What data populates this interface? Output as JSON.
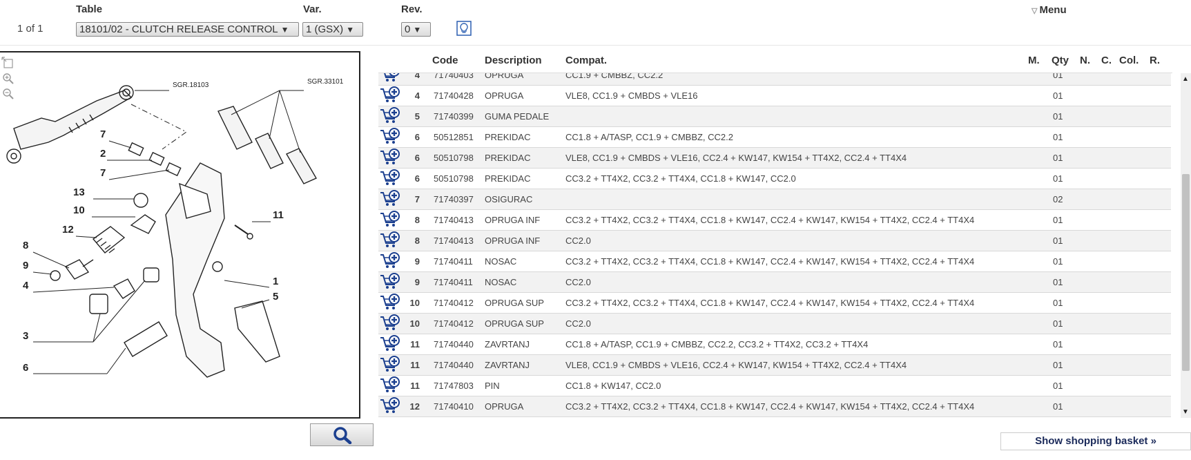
{
  "header": {
    "counter": "1 of 1",
    "table_label": "Table",
    "var_label": "Var.",
    "rev_label": "Rev.",
    "table_value": "18101/02 - CLUTCH RELEASE CONTROL",
    "var_value": "1 (GSX)",
    "rev_value": "0",
    "menu_label": "Menu"
  },
  "diagram": {
    "labels": [
      "7",
      "2",
      "7",
      "13",
      "10",
      "12",
      "8",
      "9",
      "4",
      "3",
      "6",
      "11",
      "1",
      "5"
    ],
    "refs": [
      "SGR.18103",
      "SGR.33101"
    ]
  },
  "table": {
    "headers": [
      "Code",
      "Description",
      "Compat.",
      "M.",
      "Qty",
      "N.",
      "C.",
      "Col.",
      "R."
    ],
    "rows": [
      {
        "pos": "4",
        "code": "71740403",
        "desc": "OPRUGA",
        "compat": "CC1.9 + CMBBZ, CC2.2",
        "qty": "01"
      },
      {
        "pos": "4",
        "code": "71740428",
        "desc": "OPRUGA",
        "compat": "VLE8, CC1.9 + CMBDS + VLE16",
        "qty": "01"
      },
      {
        "pos": "5",
        "code": "71740399",
        "desc": "GUMA PEDALE",
        "compat": "",
        "qty": "01"
      },
      {
        "pos": "6",
        "code": "50512851",
        "desc": "PREKIDAC",
        "compat": "CC1.8 + A/TASP, CC1.9 + CMBBZ, CC2.2",
        "qty": "01"
      },
      {
        "pos": "6",
        "code": "50510798",
        "desc": "PREKIDAC",
        "compat": "VLE8, CC1.9 + CMBDS + VLE16, CC2.4 + KW147, KW154 + TT4X2, CC2.4 + TT4X4",
        "qty": "01"
      },
      {
        "pos": "6",
        "code": "50510798",
        "desc": "PREKIDAC",
        "compat": "CC3.2 + TT4X2, CC3.2 + TT4X4, CC1.8 + KW147, CC2.0",
        "qty": "01"
      },
      {
        "pos": "7",
        "code": "71740397",
        "desc": "OSIGURAC",
        "compat": "",
        "qty": "02"
      },
      {
        "pos": "8",
        "code": "71740413",
        "desc": "OPRUGA INF",
        "compat": "CC3.2 + TT4X2, CC3.2 + TT4X4, CC1.8 + KW147, CC2.4 + KW147, KW154 + TT4X2, CC2.4 + TT4X4",
        "qty": "01"
      },
      {
        "pos": "8",
        "code": "71740413",
        "desc": "OPRUGA INF",
        "compat": "CC2.0",
        "qty": "01"
      },
      {
        "pos": "9",
        "code": "71740411",
        "desc": "NOSAC",
        "compat": "CC3.2 + TT4X2, CC3.2 + TT4X4, CC1.8 + KW147, CC2.4 + KW147, KW154 + TT4X2, CC2.4 + TT4X4",
        "qty": "01"
      },
      {
        "pos": "9",
        "code": "71740411",
        "desc": "NOSAC",
        "compat": "CC2.0",
        "qty": "01"
      },
      {
        "pos": "10",
        "code": "71740412",
        "desc": "OPRUGA SUP",
        "compat": "CC3.2 + TT4X2, CC3.2 + TT4X4, CC1.8 + KW147, CC2.4 + KW147, KW154 + TT4X2, CC2.4 + TT4X4",
        "qty": "01"
      },
      {
        "pos": "10",
        "code": "71740412",
        "desc": "OPRUGA SUP",
        "compat": "CC2.0",
        "qty": "01"
      },
      {
        "pos": "11",
        "code": "71740440",
        "desc": "ZAVRTANJ",
        "compat": "CC1.8 + A/TASP, CC1.9 + CMBBZ, CC2.2, CC3.2 + TT4X2, CC3.2 + TT4X4",
        "qty": "01"
      },
      {
        "pos": "11",
        "code": "71740440",
        "desc": "ZAVRTANJ",
        "compat": "VLE8, CC1.9 + CMBDS + VLE16, CC2.4 + KW147, KW154 + TT4X2, CC2.4 + TT4X4",
        "qty": "01"
      },
      {
        "pos": "11",
        "code": "71747803",
        "desc": "PIN",
        "compat": "CC1.8 + KW147, CC2.0",
        "qty": "01"
      },
      {
        "pos": "12",
        "code": "71740410",
        "desc": "OPRUGA",
        "compat": "CC3.2 + TT4X2, CC3.2 + TT4X4, CC1.8 + KW147, CC2.4 + KW147, KW154 + TT4X2, CC2.4 + TT4X4",
        "qty": "01"
      }
    ]
  },
  "footer": {
    "basket_label": "Show shopping basket »"
  },
  "icons": {
    "cart": "add-to-cart-icon",
    "zoom": "magnifier-icon",
    "bulb": "lightbulb-icon"
  },
  "colors": {
    "basket_text": "#1b2a5a",
    "row_alt": "#f2f2f2"
  }
}
